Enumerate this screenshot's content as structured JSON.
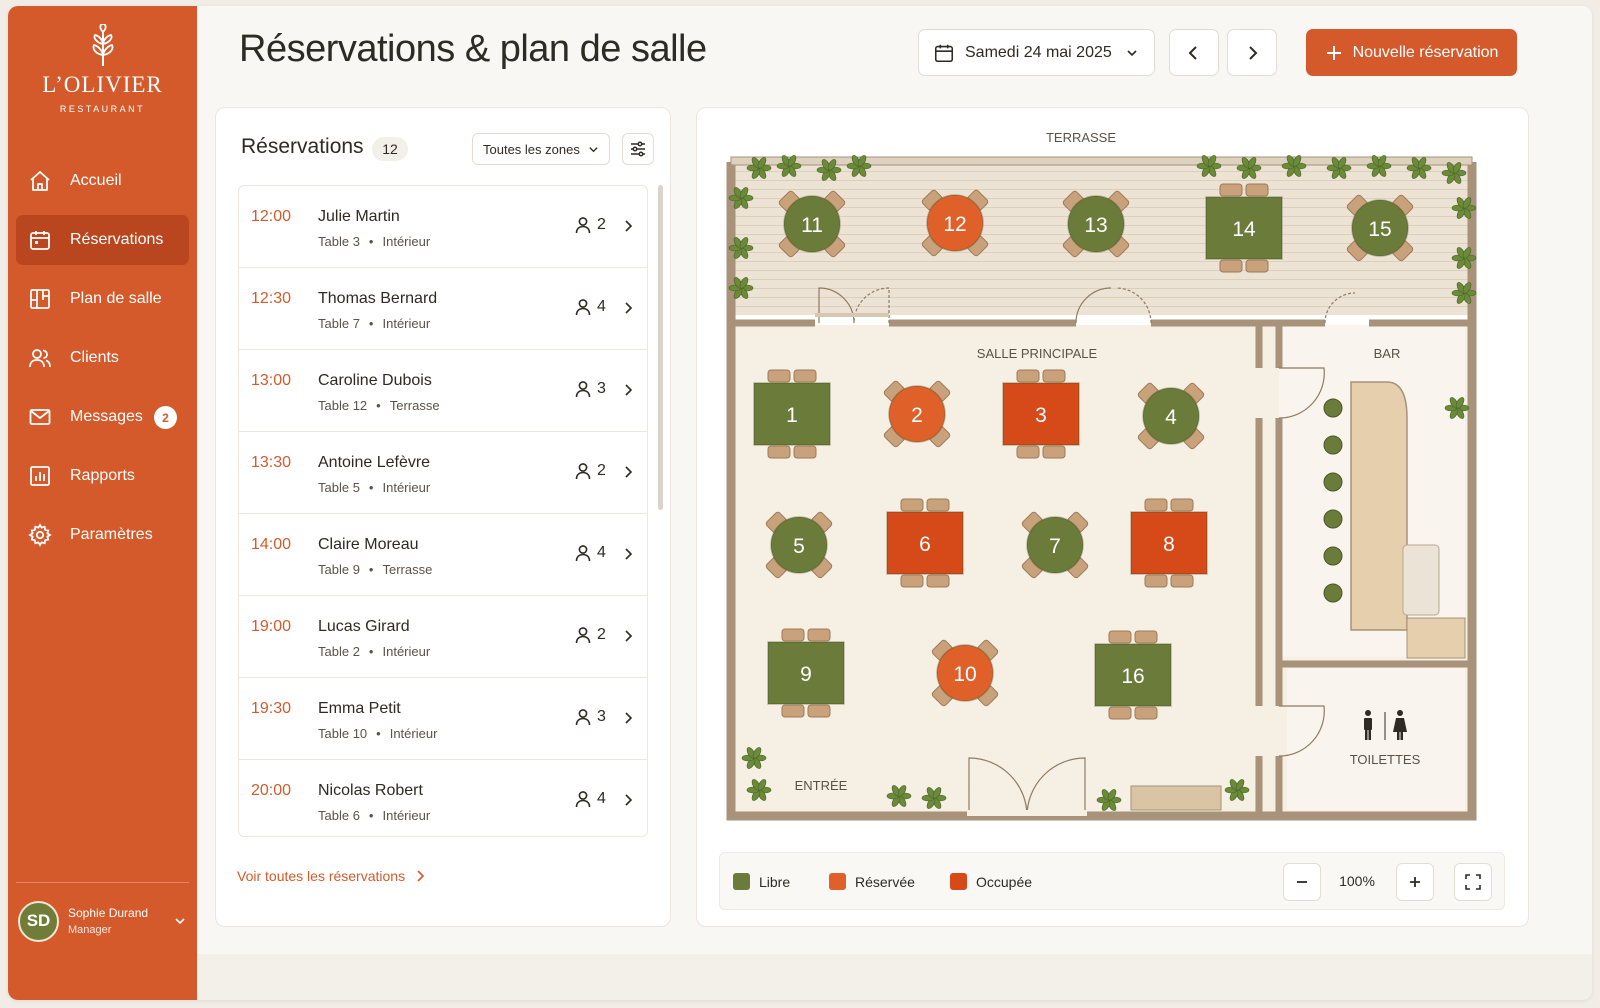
{
  "brand": {
    "name": "L’OLIVIER",
    "subtitle": "RESTAURANT"
  },
  "sidebar": {
    "items": [
      {
        "label": "Accueil",
        "icon": "home-icon",
        "active": false
      },
      {
        "label": "Réservations",
        "icon": "calendar-icon",
        "active": true
      },
      {
        "label": "Plan de salle",
        "icon": "floor-plan-icon",
        "active": false
      },
      {
        "label": "Clients",
        "icon": "users-icon",
        "active": false
      },
      {
        "label": "Messages",
        "icon": "mail-icon",
        "active": false,
        "badge": "2"
      },
      {
        "label": "Rapports",
        "icon": "chart-icon",
        "active": false
      },
      {
        "label": "Paramètres",
        "icon": "gear-icon",
        "active": false
      }
    ],
    "user": {
      "initials": "SD",
      "name": "Sophie Durand",
      "role": "Manager"
    }
  },
  "header": {
    "title": "Réservations & plan de salle",
    "date": "Samedi 24 mai 2025",
    "new_button": "Nouvelle réservation"
  },
  "reservations": {
    "title": "Réservations",
    "count": "12",
    "zone_filter": "Toutes les zones",
    "see_all": "Voir toutes les réservations",
    "items": [
      {
        "time": "12:00",
        "name": "Julie Martin",
        "table": "Table 3",
        "zone": "Intérieur",
        "guests": "2"
      },
      {
        "time": "12:30",
        "name": "Thomas Bernard",
        "table": "Table 7",
        "zone": "Intérieur",
        "guests": "4"
      },
      {
        "time": "13:00",
        "name": "Caroline Dubois",
        "table": "Table 12",
        "zone": "Terrasse",
        "guests": "3"
      },
      {
        "time": "13:30",
        "name": "Antoine Lefèvre",
        "table": "Table 5",
        "zone": "Intérieur",
        "guests": "2"
      },
      {
        "time": "14:00",
        "name": "Claire Moreau",
        "table": "Table 9",
        "zone": "Terrasse",
        "guests": "4"
      },
      {
        "time": "19:00",
        "name": "Lucas Girard",
        "table": "Table 2",
        "zone": "Intérieur",
        "guests": "2"
      },
      {
        "time": "19:30",
        "name": "Emma Petit",
        "table": "Table 10",
        "zone": "Intérieur",
        "guests": "3"
      },
      {
        "time": "20:00",
        "name": "Nicolas Robert",
        "table": "Table 6",
        "zone": "Intérieur",
        "guests": "4"
      }
    ]
  },
  "floor_plan": {
    "zones": {
      "terrace": "TERRASSE",
      "main": "SALLE PRINCIPALE",
      "bar": "BAR",
      "toilets": "TOILETTES",
      "entrance": "ENTRÉE"
    },
    "tables": [
      {
        "number": "11",
        "status": "libre",
        "shape": "round"
      },
      {
        "number": "12",
        "status": "reservee",
        "shape": "round"
      },
      {
        "number": "13",
        "status": "libre",
        "shape": "round"
      },
      {
        "number": "14",
        "status": "libre",
        "shape": "square"
      },
      {
        "number": "15",
        "status": "libre",
        "shape": "round"
      },
      {
        "number": "1",
        "status": "libre",
        "shape": "square"
      },
      {
        "number": "2",
        "status": "reservee",
        "shape": "round"
      },
      {
        "number": "3",
        "status": "occupee",
        "shape": "square"
      },
      {
        "number": "4",
        "status": "libre",
        "shape": "round"
      },
      {
        "number": "5",
        "status": "libre",
        "shape": "round"
      },
      {
        "number": "6",
        "status": "occupee",
        "shape": "square"
      },
      {
        "number": "7",
        "status": "libre",
        "shape": "round"
      },
      {
        "number": "8",
        "status": "occupee",
        "shape": "square"
      },
      {
        "number": "9",
        "status": "libre",
        "shape": "square"
      },
      {
        "number": "10",
        "status": "reservee",
        "shape": "round"
      },
      {
        "number": "16",
        "status": "libre",
        "shape": "square"
      }
    ],
    "legend": [
      {
        "label": "Libre",
        "color": "#6b7b3a"
      },
      {
        "label": "Réservée",
        "color": "#e0602a"
      },
      {
        "label": "Occupée",
        "color": "#d64a1a"
      }
    ],
    "zoom": "100%"
  },
  "colors": {
    "accent": "#d45a2b",
    "free": "#6b7b3a",
    "reserved": "#e0602a",
    "occupied": "#d64a1a"
  }
}
